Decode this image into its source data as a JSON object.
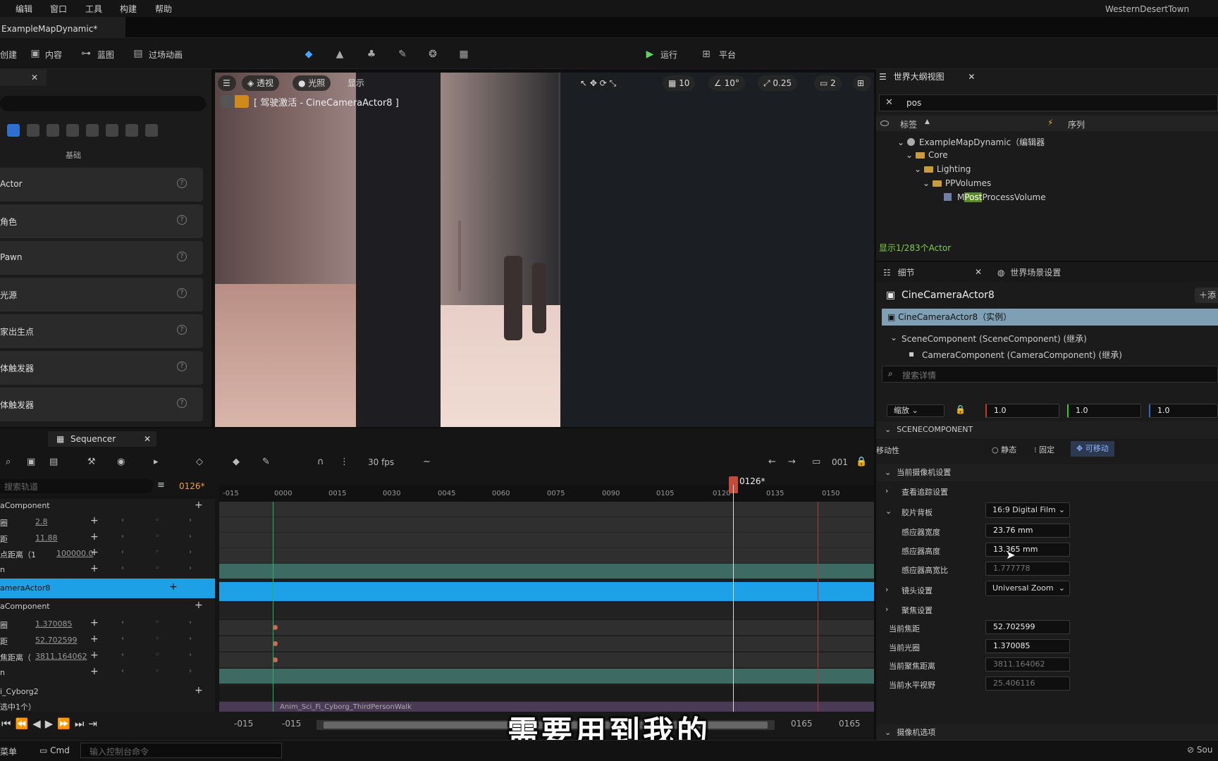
{
  "menu": [
    "编辑",
    "窗口",
    "工具",
    "构建",
    "帮助"
  ],
  "project_name": "WesternDesertTown",
  "map_tab": "ExampleMapDynamic*",
  "toolbar": {
    "create": "创建",
    "content": "内容",
    "blueprint": "蓝图",
    "cinematics": "过场动画",
    "run": "运行",
    "platform": "平台"
  },
  "place_actors": {
    "category": "基础",
    "items": [
      "Actor",
      "角色",
      "Pawn",
      "光源",
      "玩家出生点",
      "盒体触发器",
      "球体触发器"
    ]
  },
  "viewport": {
    "view_mode": "透视",
    "lit": "光照",
    "show": "显示",
    "pilot_label": "[ 驾驶激活 - CineCameraActor8 ]",
    "grid": "10",
    "angle": "10°",
    "scale": "0.25",
    "camera_speed": "2"
  },
  "outliner": {
    "tab": "世界大纲视图",
    "search": "pos",
    "col_label": "标签",
    "col_sequence": "序列",
    "tree": [
      {
        "label": "ExampleMapDynamic（编辑器",
        "depth": 0
      },
      {
        "label": "Core",
        "depth": 1
      },
      {
        "label": "Lighting",
        "depth": 2
      },
      {
        "label": "PPVolumes",
        "depth": 3
      }
    ],
    "match_pre": "M",
    "match_hi": "Post",
    "match_post": "ProcessVolume",
    "status": "显示1/283个Actor"
  },
  "details": {
    "tab": "细节",
    "tab2": "世界场景设置",
    "actor_name": "CineCameraActor8",
    "add": "添",
    "instance": "CineCameraActor8（实例）",
    "comp1": "SceneComponent (SceneComponent) (继承)",
    "comp2": "CameraComponent (CameraComponent) (继承)",
    "search_placeholder": "搜索详情",
    "scale_label": "缩放",
    "scale": [
      "1.0",
      "1.0",
      "1.0"
    ],
    "scene_section": "SCENECOMPONENT",
    "mobility_label": "移动性",
    "mobility": [
      "静态",
      "固定",
      "可移动"
    ],
    "camera_settings": "当前摄像机设置",
    "lookat": "查看追踪设置",
    "filmback": "胶片背板",
    "filmback_value": "16:9 Digital Film",
    "sensor_width_label": "感应器宽度",
    "sensor_width": "23.76 mm",
    "sensor_height_label": "感应器高度",
    "sensor_height": "13.365 mm",
    "aspect_label": "感应器高宽比",
    "aspect": "1.777778",
    "lens_label": "镜头设置",
    "lens_value": "Universal Zoom",
    "focus_label": "聚焦设置",
    "focal_label": "当前焦距",
    "focal": "52.702599",
    "aperture_label": "当前光圈",
    "aperture": "1.370085",
    "focus_dist_label": "当前聚焦距离",
    "focus_dist": "3811.164062",
    "hfov_label": "当前水平视野",
    "hfov": "25.406116",
    "camera_options": "摄像机选项"
  },
  "sequencer": {
    "tab": "Sequencer",
    "fps": "30 fps",
    "frame_box": "001",
    "search_placeholder": "搜索轨道",
    "current_frame": "0126*",
    "ruler": [
      "-015",
      "0000",
      "0015",
      "0030",
      "0045",
      "0060",
      "0075",
      "0090",
      "0105",
      "0120",
      "0135",
      "0150"
    ],
    "tracks": [
      {
        "name": "aComponent",
        "value": ""
      },
      {
        "name": "圈",
        "value": "2.8"
      },
      {
        "name": "距",
        "value": "11.88"
      },
      {
        "name": "点距离（1",
        "value": "100000.0"
      },
      {
        "name": "n",
        "value": ""
      },
      {
        "name": "ameraActor8",
        "value": ""
      },
      {
        "name": "aComponent",
        "value": ""
      },
      {
        "name": "圈",
        "value": "1.370085"
      },
      {
        "name": "距",
        "value": "52.702599"
      },
      {
        "name": "焦距离（",
        "value": "3811.164062"
      },
      {
        "name": "n",
        "value": ""
      },
      {
        "name": "i_Cyborg2",
        "value": ""
      },
      {
        "name": "选中1个）",
        "value": ""
      }
    ],
    "clip_label": "Anim_Sci_Fi_Cyborg_ThirdPersonWalk",
    "range_start": "-015",
    "range_start2": "-015",
    "range_end": "0165",
    "range_end2": "0165"
  },
  "statusbar": {
    "menu": "菜单",
    "cmd": "Cmd",
    "console_placeholder": "输入控制台命令",
    "source": "Sou"
  },
  "subtitle": "需要用到我的"
}
